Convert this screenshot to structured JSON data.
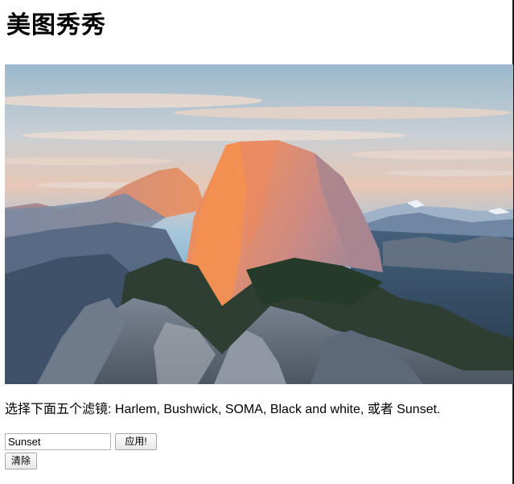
{
  "page": {
    "title": "美图秀秀",
    "instructions": "选择下面五个滤镜: Harlem, Bushwick, SOMA, Black and white, 或者 Sunset."
  },
  "form": {
    "filter_value": "Sunset",
    "apply_label": "应用!",
    "clear_label": "清除"
  },
  "photo": {
    "subject": "mountain landscape at sunset"
  },
  "colors": {
    "text": "#000000",
    "sky_top": "#8fb5cf",
    "rock_light": "#e9a07a",
    "rock_shadow": "#4d5f75"
  }
}
